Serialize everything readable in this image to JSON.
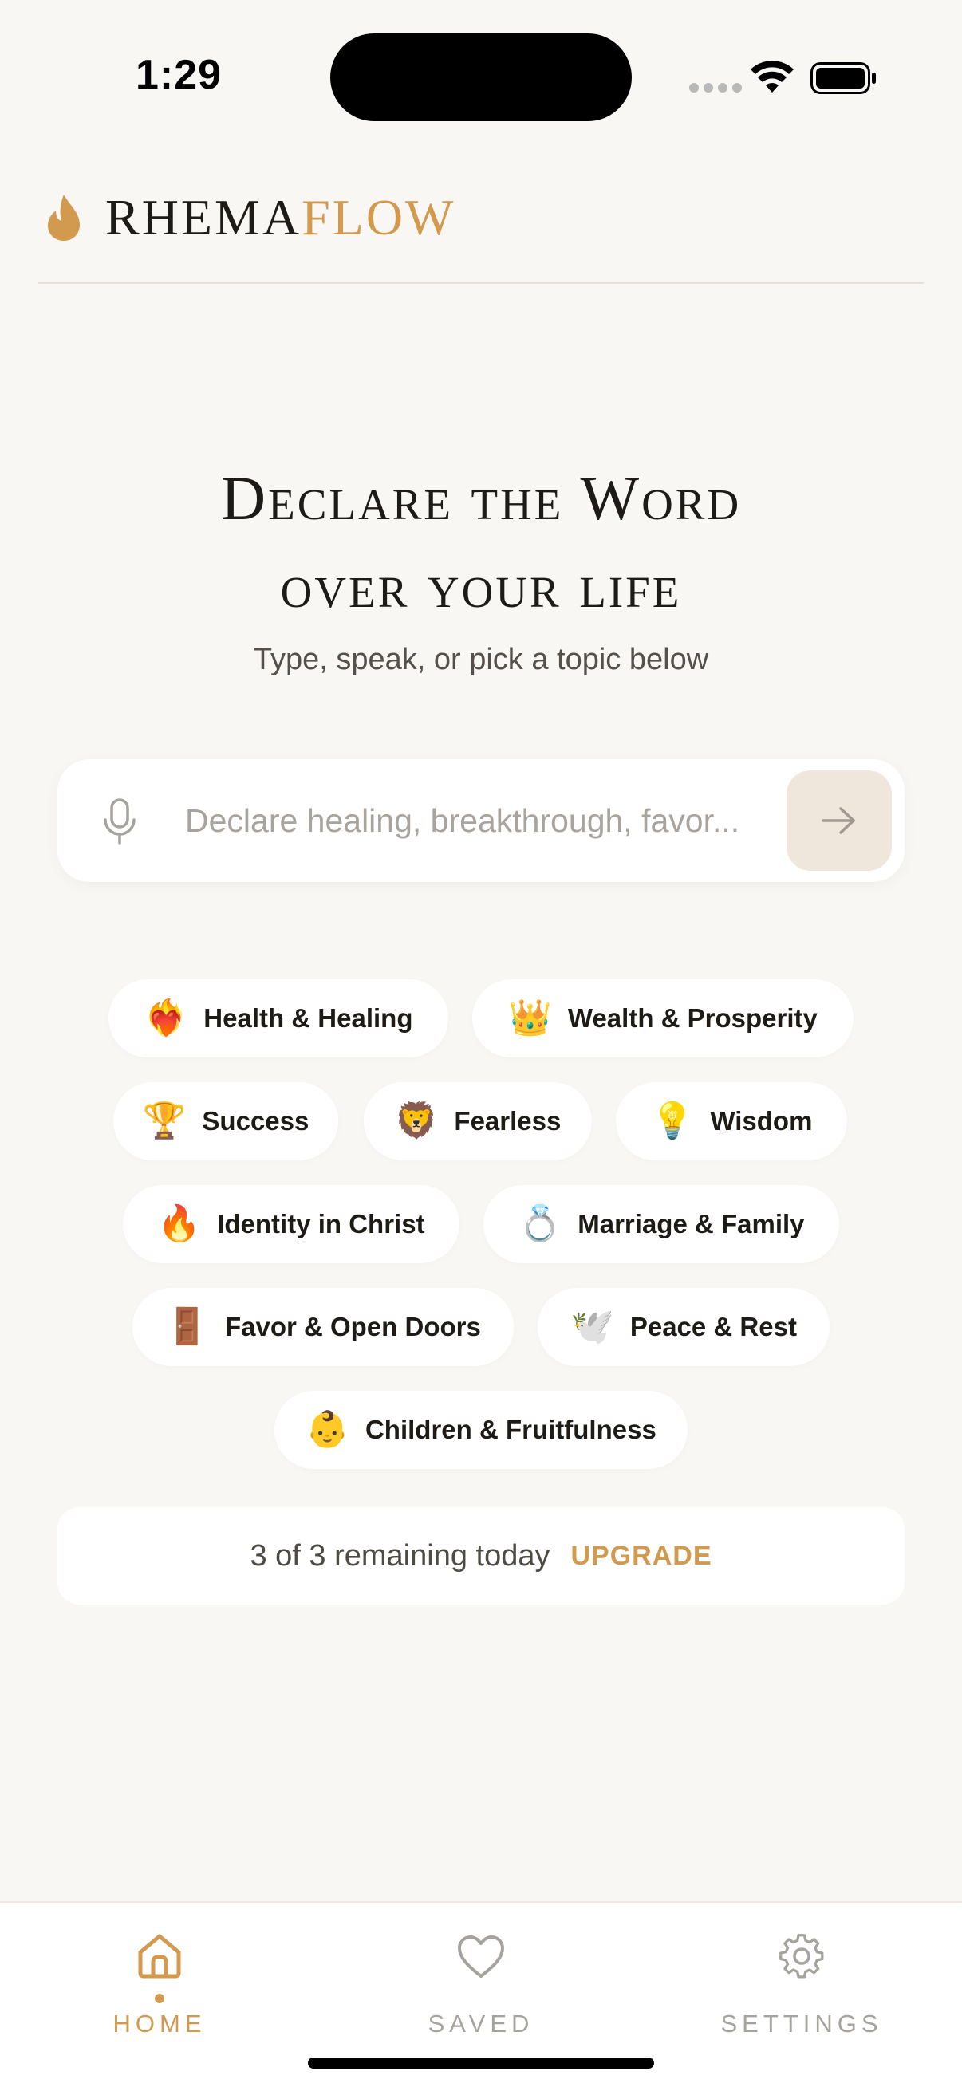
{
  "status_bar": {
    "time": "1:29"
  },
  "brand": {
    "name_primary": "RHEMA",
    "name_accent": "FLOW"
  },
  "hero": {
    "title_line1": "Declare the Word",
    "title_line2": "over your life",
    "subtitle": "Type, speak, or pick a topic below"
  },
  "search": {
    "placeholder": "Declare healing, breakthrough, favor...",
    "value": ""
  },
  "topics": [
    {
      "emoji": "❤️‍🔥",
      "label": "Health & Healing"
    },
    {
      "emoji": "👑",
      "label": "Wealth & Prosperity"
    },
    {
      "emoji": "🏆",
      "label": "Success"
    },
    {
      "emoji": "🦁",
      "label": "Fearless"
    },
    {
      "emoji": "💡",
      "label": "Wisdom"
    },
    {
      "emoji": "🔥",
      "label": "Identity in Christ"
    },
    {
      "emoji": "💍",
      "label": "Marriage & Family"
    },
    {
      "emoji": "🚪",
      "label": "Favor & Open Doors"
    },
    {
      "emoji": "🕊️",
      "label": "Peace & Rest"
    },
    {
      "emoji": "👶",
      "label": "Children & Fruitfulness"
    }
  ],
  "quota": {
    "text": "3 of 3 remaining today",
    "upgrade_label": "UPGRADE"
  },
  "tabs": [
    {
      "label": "HOME",
      "icon": "home-icon",
      "active": true
    },
    {
      "label": "SAVED",
      "icon": "heart-icon",
      "active": false
    },
    {
      "label": "SETTINGS",
      "icon": "gear-icon",
      "active": false
    }
  ],
  "colors": {
    "accent": "#d19a4f",
    "background": "#f9f7f3",
    "inactive": "#a6a29c"
  }
}
